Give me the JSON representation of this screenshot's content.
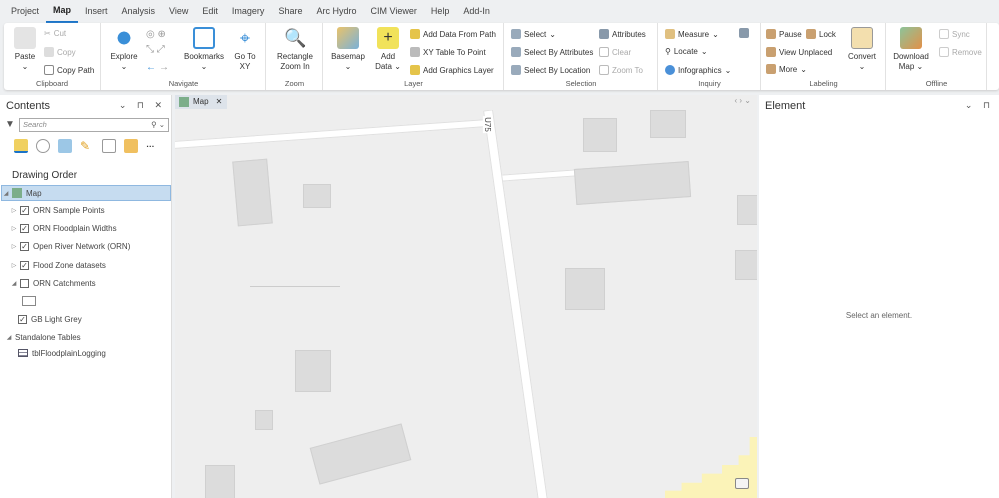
{
  "tabs": [
    "Project",
    "Map",
    "Insert",
    "Analysis",
    "View",
    "Edit",
    "Imagery",
    "Share",
    "Arc Hydro",
    "CIM Viewer",
    "Help",
    "Add-In"
  ],
  "active_tab": "Map",
  "ribbon": {
    "clipboard": {
      "label": "Clipboard",
      "paste": "Paste",
      "cut": "Cut",
      "copy": "Copy",
      "copy_path": "Copy Path"
    },
    "navigate": {
      "label": "Navigate",
      "explore": "Explore",
      "bookmarks": "Bookmarks",
      "go_to_xy": "Go To XY"
    },
    "zoom": {
      "label": "Zoom",
      "rect": "Rectangle Zoom In"
    },
    "layer": {
      "label": "Layer",
      "basemap": "Basemap",
      "add_data": "Add Data",
      "add_path": "Add Data From Path",
      "xy": "XY Table To Point",
      "graphics": "Add Graphics Layer"
    },
    "selection": {
      "label": "Selection",
      "select": "Select",
      "by_attr": "Select By Attributes",
      "by_loc": "Select By Location",
      "attributes": "Attributes",
      "clear": "Clear",
      "zoom_to": "Zoom To"
    },
    "inquiry": {
      "label": "Inquiry",
      "measure": "Measure",
      "locate": "Locate",
      "infographics": "Infographics"
    },
    "labeling": {
      "label": "Labeling",
      "pause": "Pause",
      "lock": "Lock",
      "view_unplaced": "View Unplaced",
      "more": "More",
      "convert": "Convert"
    },
    "offline": {
      "label": "Offline",
      "download": "Download Map",
      "sync": "Sync",
      "remove": "Remove"
    }
  },
  "contents": {
    "title": "Contents",
    "search_placeholder": "Search",
    "drawing_order": "Drawing Order",
    "map": "Map",
    "layers": [
      {
        "name": "ORN Sample Points",
        "checked": true
      },
      {
        "name": "ORN Floodplain Widths",
        "checked": true
      },
      {
        "name": "Open River Network (ORN)",
        "checked": true
      },
      {
        "name": "Flood Zone datasets",
        "checked": true
      },
      {
        "name": "ORN Catchments",
        "checked": false
      },
      {
        "name": "GB Light Grey",
        "checked": true
      }
    ],
    "standalone": "Standalone Tables",
    "table": "tblFloodplainLogging"
  },
  "map": {
    "tab": "Map",
    "road_label": "U75"
  },
  "element": {
    "title": "Element",
    "empty": "Select an element."
  }
}
